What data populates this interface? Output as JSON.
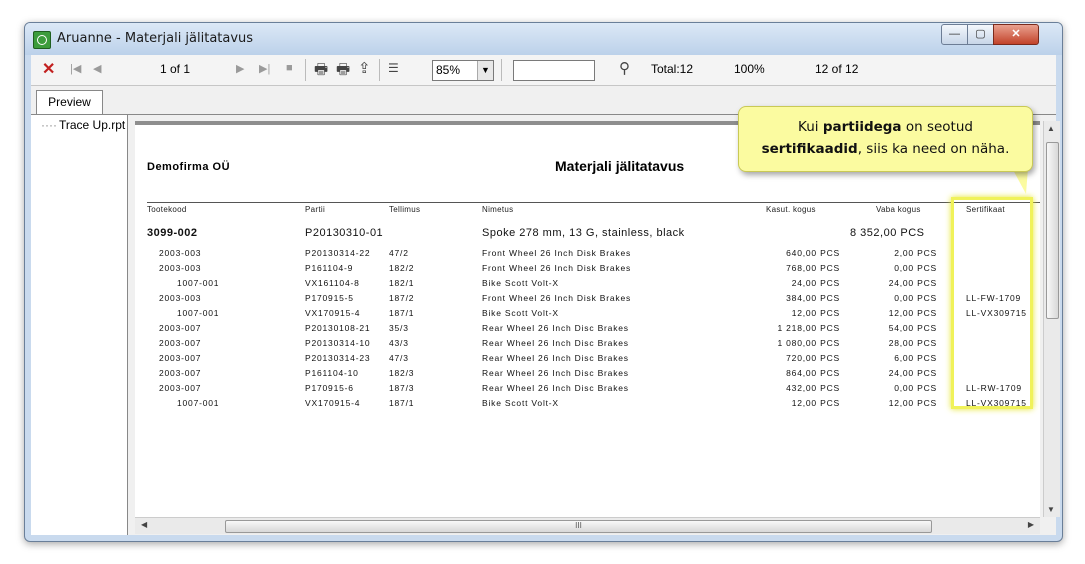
{
  "window": {
    "title": "Aruanne - Materjali jälitatavus"
  },
  "toolbar": {
    "page_indicator": "1 of 1",
    "zoom": "85%",
    "total": "Total:12",
    "percent": "100%",
    "count": "12 of 12",
    "search_value": ""
  },
  "tabs": {
    "preview": "Preview"
  },
  "tree": {
    "item": "Trace Up.rpt"
  },
  "report": {
    "company": "Demofirma OÜ",
    "title": "Materjali jälitatavus",
    "headers": [
      "Tootekood",
      "Partii",
      "Tellimus",
      "Nimetus",
      "Kasut. kogus",
      "Vaba kogus",
      "Sertifikaat"
    ],
    "main_row": {
      "code": "3099-002",
      "batch": "P20130310-01",
      "name": "Spoke 278 mm, 13 G, stainless, black",
      "free": "8 352,00 PCS"
    },
    "rows": [
      {
        "code": "2003-003",
        "batch": "P20130314-22",
        "order": "47/2",
        "name": "Front Wheel 26 Inch Disk Brakes",
        "used": "640,00 PCS",
        "free": "2,00 PCS",
        "cert": "",
        "indent": false
      },
      {
        "code": "2003-003",
        "batch": "P161104-9",
        "order": "182/2",
        "name": "Front Wheel 26 Inch Disk Brakes",
        "used": "768,00 PCS",
        "free": "0,00 PCS",
        "cert": "",
        "indent": false
      },
      {
        "code": "1007-001",
        "batch": "VX161104-8",
        "order": "182/1",
        "name": "Bike Scott Volt-X",
        "used": "24,00 PCS",
        "free": "24,00 PCS",
        "cert": "",
        "indent": true
      },
      {
        "code": "2003-003",
        "batch": "P170915-5",
        "order": "187/2",
        "name": "Front Wheel 26 Inch Disk Brakes",
        "used": "384,00 PCS",
        "free": "0,00 PCS",
        "cert": "LL-FW-1709",
        "indent": false
      },
      {
        "code": "1007-001",
        "batch": "VX170915-4",
        "order": "187/1",
        "name": "Bike Scott Volt-X",
        "used": "12,00 PCS",
        "free": "12,00 PCS",
        "cert": "LL-VX309715",
        "indent": true
      },
      {
        "code": "2003-007",
        "batch": "P20130108-21",
        "order": "35/3",
        "name": "Rear Wheel 26 Inch Disc Brakes",
        "used": "1 218,00 PCS",
        "free": "54,00 PCS",
        "cert": "",
        "indent": false
      },
      {
        "code": "2003-007",
        "batch": "P20130314-10",
        "order": "43/3",
        "name": "Rear Wheel 26 Inch Disc Brakes",
        "used": "1 080,00 PCS",
        "free": "28,00 PCS",
        "cert": "",
        "indent": false
      },
      {
        "code": "2003-007",
        "batch": "P20130314-23",
        "order": "47/3",
        "name": "Rear Wheel 26 Inch Disc Brakes",
        "used": "720,00 PCS",
        "free": "6,00 PCS",
        "cert": "",
        "indent": false
      },
      {
        "code": "2003-007",
        "batch": "P161104-10",
        "order": "182/3",
        "name": "Rear Wheel 26 Inch Disc Brakes",
        "used": "864,00 PCS",
        "free": "24,00 PCS",
        "cert": "",
        "indent": false
      },
      {
        "code": "2003-007",
        "batch": "P170915-6",
        "order": "187/3",
        "name": "Rear Wheel 26 Inch Disc Brakes",
        "used": "432,00 PCS",
        "free": "0,00 PCS",
        "cert": "LL-RW-1709",
        "indent": false
      },
      {
        "code": "1007-001",
        "batch": "VX170915-4",
        "order": "187/1",
        "name": "Bike Scott Volt-X",
        "used": "12,00 PCS",
        "free": "12,00 PCS",
        "cert": "LL-VX309715",
        "indent": true
      }
    ]
  },
  "callout": {
    "l1_pre": "Kui ",
    "l1_bold": "partiidega",
    "l1_post": " on seotud",
    "l2_bold": "sertifikaadid",
    "l2_post": ", siis ka need on näha."
  },
  "scrollbar": {
    "grip": "III"
  },
  "colors": {
    "highlight": "#f0f25a",
    "callout_bg": "#fbfba0",
    "close_button": "#c2432a"
  }
}
